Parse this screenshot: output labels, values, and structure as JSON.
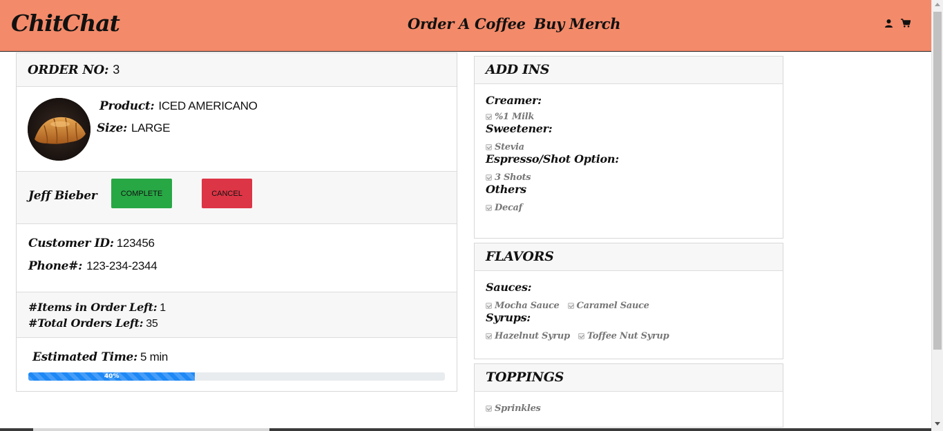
{
  "nav": {
    "brand": "ChitChat",
    "links": [
      "Order A Coffee",
      "Buy Merch"
    ],
    "icons": [
      "user-icon",
      "cart-icon"
    ],
    "bg_color": "#f38a69"
  },
  "order": {
    "label": "ORDER NO:",
    "number": "3",
    "product_label": "Product:",
    "product": "ICED AMERICANO",
    "size_label": "Size:",
    "size": "LARGE",
    "customer_name": "Jeff Bieber",
    "complete_label": "COMPLETE",
    "cancel_label": "CANCEL",
    "customer_id_label": "Customer ID:",
    "customer_id": "123456",
    "phone_label": "Phone#:",
    "phone": "123-234-2344",
    "items_left_label": "#Items in Order Left:",
    "items_left": "1",
    "orders_left_label": "#Total Orders Left:",
    "orders_left": "35",
    "est_label": "Estimated Time:",
    "est_value": "5 min",
    "progress_percent": 40,
    "progress_text": "40%"
  },
  "addins": {
    "title": "ADD INS",
    "groups": [
      {
        "title": "Creamer:",
        "options": [
          "%1 Milk"
        ]
      },
      {
        "title": "Sweetener:",
        "options": [
          "Stevia"
        ]
      },
      {
        "title": "Espresso/Shot Option:",
        "options": [
          "3 Shots"
        ]
      },
      {
        "title": "Others",
        "options": [
          "Decaf"
        ]
      }
    ]
  },
  "flavors": {
    "title": "FLAVORS",
    "groups": [
      {
        "title": "Sauces:",
        "options": [
          "Mocha Sauce",
          "Caramel Sauce"
        ]
      },
      {
        "title": "Syrups:",
        "options": [
          "Hazelnut Syrup",
          "Toffee Nut Syrup"
        ]
      }
    ]
  },
  "toppings": {
    "title": "TOPPINGS",
    "options": [
      "Sprinkles"
    ]
  }
}
